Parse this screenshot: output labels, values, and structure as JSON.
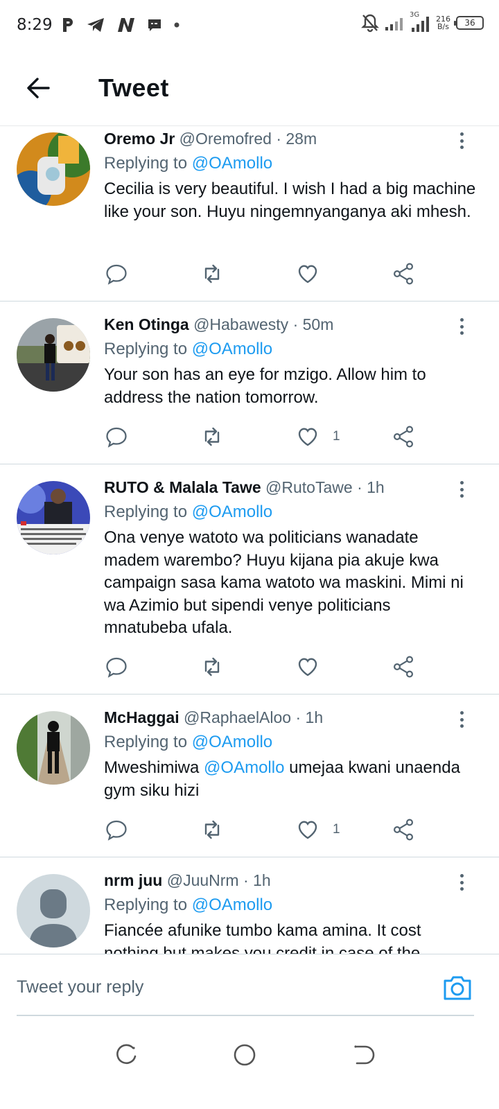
{
  "status_bar": {
    "time": "8:29",
    "net_speed_value": "216",
    "net_speed_unit": "B/s",
    "network_label": "3G",
    "battery": "36"
  },
  "header": {
    "title": "Tweet",
    "back_icon": "arrow-left-icon"
  },
  "replying_prefix": "Replying to ",
  "tweets": [
    {
      "display_name": "Oremo Jr",
      "handle": "@Oremofred",
      "time": "· 28m",
      "replying_to": "@OAmollo",
      "text_parts": [
        "Cecilia is very beautiful. I wish I had a big machine like your son. Huyu ningemnyanganya aki mhesh."
      ],
      "likes": ""
    },
    {
      "display_name": "Ken Otinga",
      "handle": "@Habawesty",
      "time": "· 50m",
      "replying_to": "@OAmollo",
      "text_parts": [
        "Your son has an eye for mzigo. Allow him to address the nation tomorrow."
      ],
      "likes": "1"
    },
    {
      "display_name": "RUTO & Malala Tawe",
      "handle": "@RutoTawe",
      "time": "· 1h",
      "replying_to": "@OAmollo",
      "text_parts": [
        "Ona venye watoto wa politicians wanadate madem warembo? Huyu kijana pia akuje kwa campaign sasa kama watoto wa maskini. Mimi ni wa Azimio but sipendi venye politicians mnatubeba ufala."
      ],
      "likes": ""
    },
    {
      "display_name": "McHaggai",
      "handle": "@RaphaelAloo",
      "time": "· 1h",
      "replying_to": "@OAmollo",
      "text_before": "Mweshimiwa ",
      "text_mention": "@OAmollo",
      "text_after": " umejaa kwani unaenda gym siku hizi",
      "likes": "1"
    },
    {
      "display_name": "nrm juu",
      "handle": "@JuuNrm",
      "time": "· 1h",
      "replying_to": "@OAmollo",
      "text_parts": [
        "Fiancée afunike tumbo kama amina. It cost nothing but makes you credit in case of the"
      ],
      "likes": ""
    }
  ],
  "reply_bar": {
    "placeholder": "Tweet your reply",
    "camera_icon": "camera-icon"
  },
  "colors": {
    "accent": "#1d9bf0",
    "text_primary": "#0f1419",
    "text_secondary": "#536471",
    "divider": "#cfd9de"
  }
}
